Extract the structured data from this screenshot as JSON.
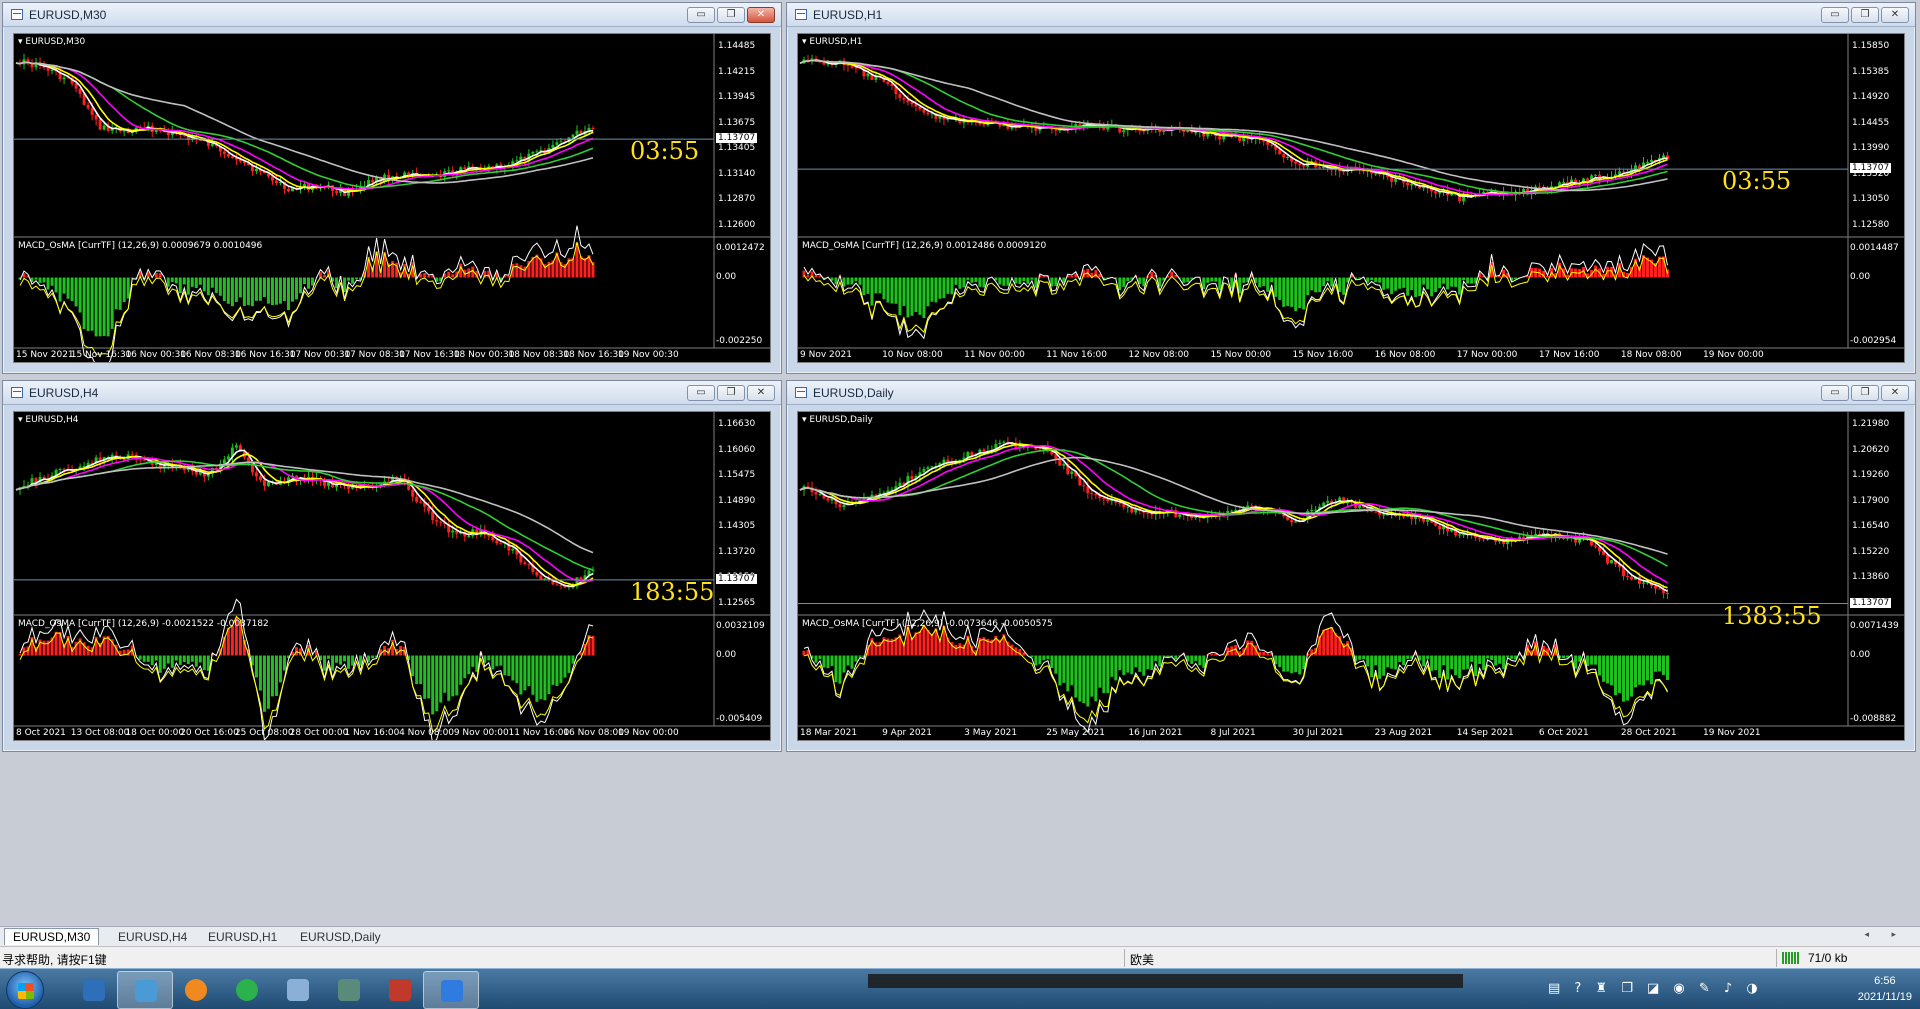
{
  "windows": [
    {
      "id": "m30",
      "title": "EURUSD,M30",
      "symbol_label": "EURUSD,M30",
      "active": true,
      "price_axis": [
        "1.14485",
        "1.14215",
        "1.13945",
        "1.13675",
        "1.13405",
        "1.13140",
        "1.12870",
        "1.12600"
      ],
      "current_price": "1.13707",
      "indicator_label": "MACD_OsMA [CurrTF] (12,26,9) 0.0009679 0.0010496",
      "indicator_axis": [
        "0.0012472",
        "0.00",
        "-0.002250"
      ],
      "time_axis": [
        "15 Nov 2021",
        "15 Nov 16:30",
        "16 Nov 00:30",
        "16 Nov 08:30",
        "16 Nov 16:30",
        "17 Nov 00:30",
        "17 Nov 08:30",
        "17 Nov 16:30",
        "18 Nov 00:30",
        "18 Nov 08:30",
        "18 Nov 16:30",
        "19 Nov 00:30"
      ],
      "countdown": "03:55"
    },
    {
      "id": "h1",
      "title": "EURUSD,H1",
      "symbol_label": "EURUSD,H1",
      "active": false,
      "price_axis": [
        "1.15850",
        "1.15385",
        "1.14920",
        "1.14455",
        "1.13990",
        "1.13520",
        "1.13050",
        "1.12580"
      ],
      "current_price": "1.13707",
      "indicator_label": "MACD_OsMA [CurrTF] (12,26,9) 0.0012486 0.0009120",
      "indicator_axis": [
        "0.0014487",
        "0.00",
        "-0.002954"
      ],
      "time_axis": [
        "9 Nov 2021",
        "10 Nov 08:00",
        "11 Nov 00:00",
        "11 Nov 16:00",
        "12 Nov 08:00",
        "15 Nov 00:00",
        "15 Nov 16:00",
        "16 Nov 08:00",
        "17 Nov 00:00",
        "17 Nov 16:00",
        "18 Nov 08:00",
        "19 Nov 00:00"
      ],
      "countdown": "03:55"
    },
    {
      "id": "h4",
      "title": "EURUSD,H4",
      "symbol_label": "EURUSD,H4",
      "active": false,
      "price_axis": [
        "1.16630",
        "1.16060",
        "1.15475",
        "1.14890",
        "1.14305",
        "1.13720",
        "1.13150",
        "1.12565"
      ],
      "current_price": "1.13707",
      "indicator_label": "MACD_OsMA [CurrTF] (12,26,9) -0.0021522 -0.0037182",
      "indicator_axis": [
        "0.0032109",
        "0.00",
        "-0.005409"
      ],
      "time_axis": [
        "8 Oct 2021",
        "13 Oct 08:00",
        "18 Oct 00:00",
        "20 Oct 16:00",
        "25 Oct 08:00",
        "28 Oct 00:00",
        "1 Nov 16:00",
        "4 Nov 08:00",
        "9 Nov 00:00",
        "11 Nov 16:00",
        "16 Nov 08:00",
        "19 Nov 00:00"
      ],
      "countdown": "183:55"
    },
    {
      "id": "d1",
      "title": "EURUSD,Daily",
      "symbol_label": "EURUSD,Daily",
      "active": false,
      "price_axis": [
        "1.21980",
        "1.20620",
        "1.19260",
        "1.17900",
        "1.16540",
        "1.15220",
        "1.13860",
        "1.12500"
      ],
      "current_price": "1.13707",
      "indicator_label": "MACD_OsMA [CurrTF] (12,26,9) -0.0073646 -0.0050575",
      "indicator_axis": [
        "0.0071439",
        "0.00",
        "-0.008882"
      ],
      "time_axis": [
        "18 Mar 2021",
        "9 Apr 2021",
        "3 May 2021",
        "25 May 2021",
        "16 Jun 2021",
        "8 Jul 2021",
        "30 Jul 2021",
        "23 Aug 2021",
        "14 Sep 2021",
        "6 Oct 2021",
        "28 Oct 2021",
        "19 Nov 2021"
      ],
      "countdown": "1383:55"
    }
  ],
  "window_buttons": {
    "minimize": "▭",
    "restore": "❐",
    "close": "✕"
  },
  "tabs": [
    "EURUSD,M30",
    "EURUSD,H4",
    "EURUSD,H1",
    "EURUSD,Daily"
  ],
  "active_tab": "EURUSD,M30",
  "tab_arrows": "◂ ▸",
  "status": {
    "help": "寻求帮助, 请按F1键",
    "profile": "欧美",
    "traffic": "71/0 kb"
  },
  "taskbar": {
    "apps": [
      {
        "name": "show-desktop-icon",
        "active": false,
        "color": "#2d6fb8"
      },
      {
        "name": "control-panel-icon",
        "active": true,
        "color": "#4a9ad6"
      },
      {
        "name": "browser-icon",
        "active": false,
        "color": "#f08a1e"
      },
      {
        "name": "wechat-icon",
        "active": false,
        "color": "#2bb24c"
      },
      {
        "name": "notepad-icon",
        "active": false,
        "color": "#8ab0d8"
      },
      {
        "name": "terminal-icon",
        "active": false,
        "color": "#5a8a7a"
      },
      {
        "name": "charts-app-icon",
        "active": false,
        "color": "#c0392b"
      },
      {
        "name": "note-app-icon",
        "active": true,
        "color": "#2f7be0"
      }
    ],
    "tray_symbols": "▤ ? ♜ ❐ ◪ ◉ ✎ ♪ ◑",
    "time": "6:56",
    "date": "2021/11/19"
  },
  "colors": {
    "bull": "#ff2020",
    "bear": "#20c020",
    "ma_fast": "#ffffff",
    "ma_yellow": "#ffff00",
    "ma_magenta": "#ff00ff",
    "ma_green": "#32cd32",
    "ma_gray": "#c0c0c0",
    "countdown": "#ffe01a"
  }
}
